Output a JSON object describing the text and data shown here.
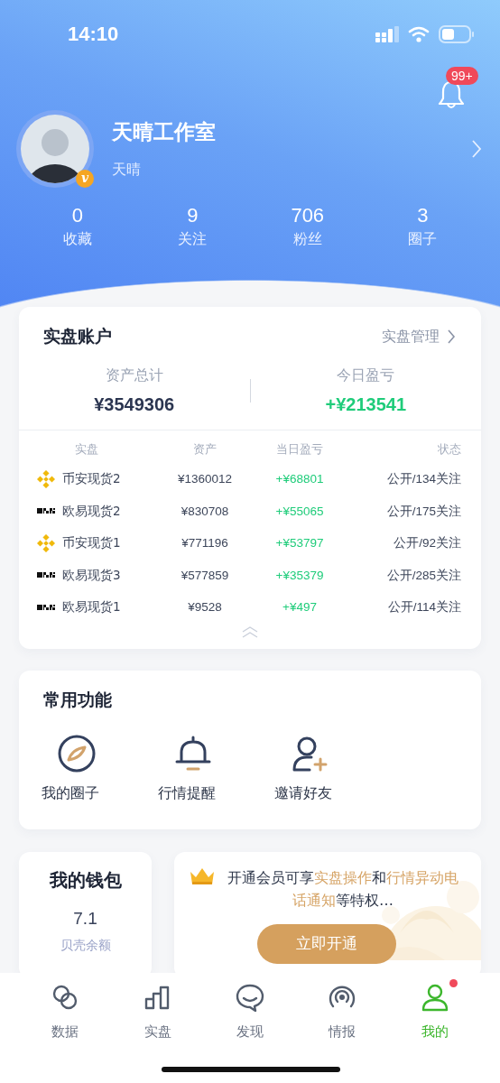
{
  "status_bar": {
    "time": "14:10"
  },
  "notifications": {
    "badge": "99+"
  },
  "profile": {
    "name": "天晴工作室",
    "subtitle": "天晴",
    "badge": "v"
  },
  "stats": [
    {
      "value": "0",
      "label": "收藏"
    },
    {
      "value": "9",
      "label": "关注"
    },
    {
      "value": "706",
      "label": "粉丝"
    },
    {
      "value": "3",
      "label": "圈子"
    }
  ],
  "accounts": {
    "title": "实盘账户",
    "manage_link": "实盘管理",
    "summary": [
      {
        "label": "资产总计",
        "value": "¥3549306",
        "kind": "plain"
      },
      {
        "label": "今日盈亏",
        "value": "+¥213541",
        "kind": "gain"
      }
    ],
    "table": {
      "columns": [
        "实盘",
        "资产",
        "当日盈亏",
        "状态"
      ],
      "rows": [
        {
          "kind": "binance",
          "name": "币安现货2",
          "assets": "¥1360012",
          "pnl": "+¥68801",
          "status": "公开/134关注"
        },
        {
          "kind": "okx",
          "name": "欧易现货2",
          "assets": "¥830708",
          "pnl": "+¥55065",
          "status": "公开/175关注"
        },
        {
          "kind": "binance",
          "name": "币安现货1",
          "assets": "¥771196",
          "pnl": "+¥53797",
          "status": "公开/92关注"
        },
        {
          "kind": "okx",
          "name": "欧易现货3",
          "assets": "¥577859",
          "pnl": "+¥35379",
          "status": "公开/285关注"
        },
        {
          "kind": "okx",
          "name": "欧易现货1",
          "assets": "¥9528",
          "pnl": "+¥497",
          "status": "公开/114关注"
        }
      ]
    }
  },
  "functions": {
    "title": "常用功能",
    "items": [
      {
        "kind": "compass",
        "label": "我的圈子"
      },
      {
        "kind": "bell",
        "label": "行情提醒"
      },
      {
        "kind": "invite",
        "label": "邀请好友"
      }
    ]
  },
  "wallet": {
    "title": "我的钱包",
    "value": "7.1",
    "label": "贝壳余额"
  },
  "promo": {
    "segments": [
      {
        "text": "开通会员可享",
        "highlight": false
      },
      {
        "text": "实盘操作",
        "highlight": true
      },
      {
        "text": "和",
        "highlight": false
      },
      {
        "text": "行情异动电话通知",
        "highlight": true
      },
      {
        "text": "等特权…",
        "highlight": false
      }
    ],
    "button": "立即开通"
  },
  "tabs": [
    {
      "kind": "data",
      "label": "数据",
      "selected": false,
      "dot": false
    },
    {
      "kind": "chart",
      "label": "实盘",
      "selected": false,
      "dot": false
    },
    {
      "kind": "chat",
      "label": "发现",
      "selected": false,
      "dot": false
    },
    {
      "kind": "signal",
      "label": "情报",
      "selected": false,
      "dot": false
    },
    {
      "kind": "person",
      "label": "我的",
      "selected": true,
      "dot": true
    }
  ]
}
